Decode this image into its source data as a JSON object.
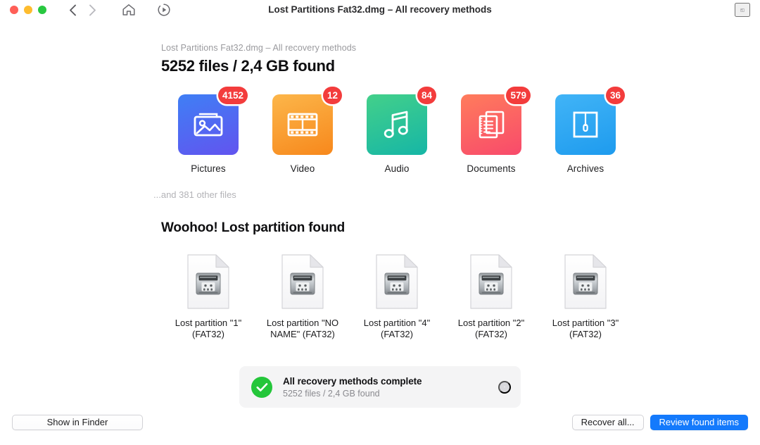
{
  "window": {
    "title": "Lost Partitions Fat32.dmg – All recovery methods",
    "traffic_lights": [
      "close",
      "minimize",
      "zoom"
    ],
    "back_icon": "chevron-left-icon",
    "forward_icon": "chevron-right-icon",
    "home_icon": "home-icon",
    "resume_icon": "resume-scan-icon",
    "panel_toggle_icon": "sidebar-toggle-icon"
  },
  "header": {
    "breadcrumb": "Lost Partitions Fat32.dmg – All recovery methods",
    "summary": "5252 files / 2,4 GB found"
  },
  "categories": [
    {
      "label": "Pictures",
      "count": "4152",
      "icon": "picture-icon",
      "color_top": "#3f7ff5",
      "color_bottom": "#6254ef"
    },
    {
      "label": "Video",
      "count": "12",
      "icon": "film-icon",
      "color_top": "#fcb64a",
      "color_bottom": "#f7881c"
    },
    {
      "label": "Audio",
      "count": "84",
      "icon": "music-icon",
      "color_top": "#43d08a",
      "color_bottom": "#16b6a6"
    },
    {
      "label": "Documents",
      "count": "579",
      "icon": "documents-icon",
      "color_top": "#ff7c5c",
      "color_bottom": "#f84a6b"
    },
    {
      "label": "Archives",
      "count": "36",
      "icon": "archive-icon",
      "color_top": "#41b4f7",
      "color_bottom": "#1e9bee"
    }
  ],
  "other_files": "...and 381 other files",
  "partitions_section": {
    "title": "Woohoo! Lost partition found",
    "items": [
      {
        "label": "Lost partition \"1\" (FAT32)",
        "icon": "disk-document-icon"
      },
      {
        "label": "Lost partition \"NO NAME\" (FAT32)",
        "icon": "disk-document-icon"
      },
      {
        "label": "Lost partition \"4\" (FAT32)",
        "icon": "disk-document-icon"
      },
      {
        "label": "Lost partition \"2\" (FAT32)",
        "icon": "disk-document-icon"
      },
      {
        "label": "Lost partition \"3\" (FAT32)",
        "icon": "disk-document-icon"
      }
    ]
  },
  "toast": {
    "status_icon": "success-check-icon",
    "title": "All recovery methods complete",
    "subtitle": "5252 files / 2,4 GB found",
    "close_icon": "close-icon",
    "accent_color": "#24c63a"
  },
  "footer": {
    "show_in_finder": "Show in Finder",
    "recover_all": "Recover all...",
    "review_found_items": "Review found items",
    "primary_color": "#147afc"
  }
}
